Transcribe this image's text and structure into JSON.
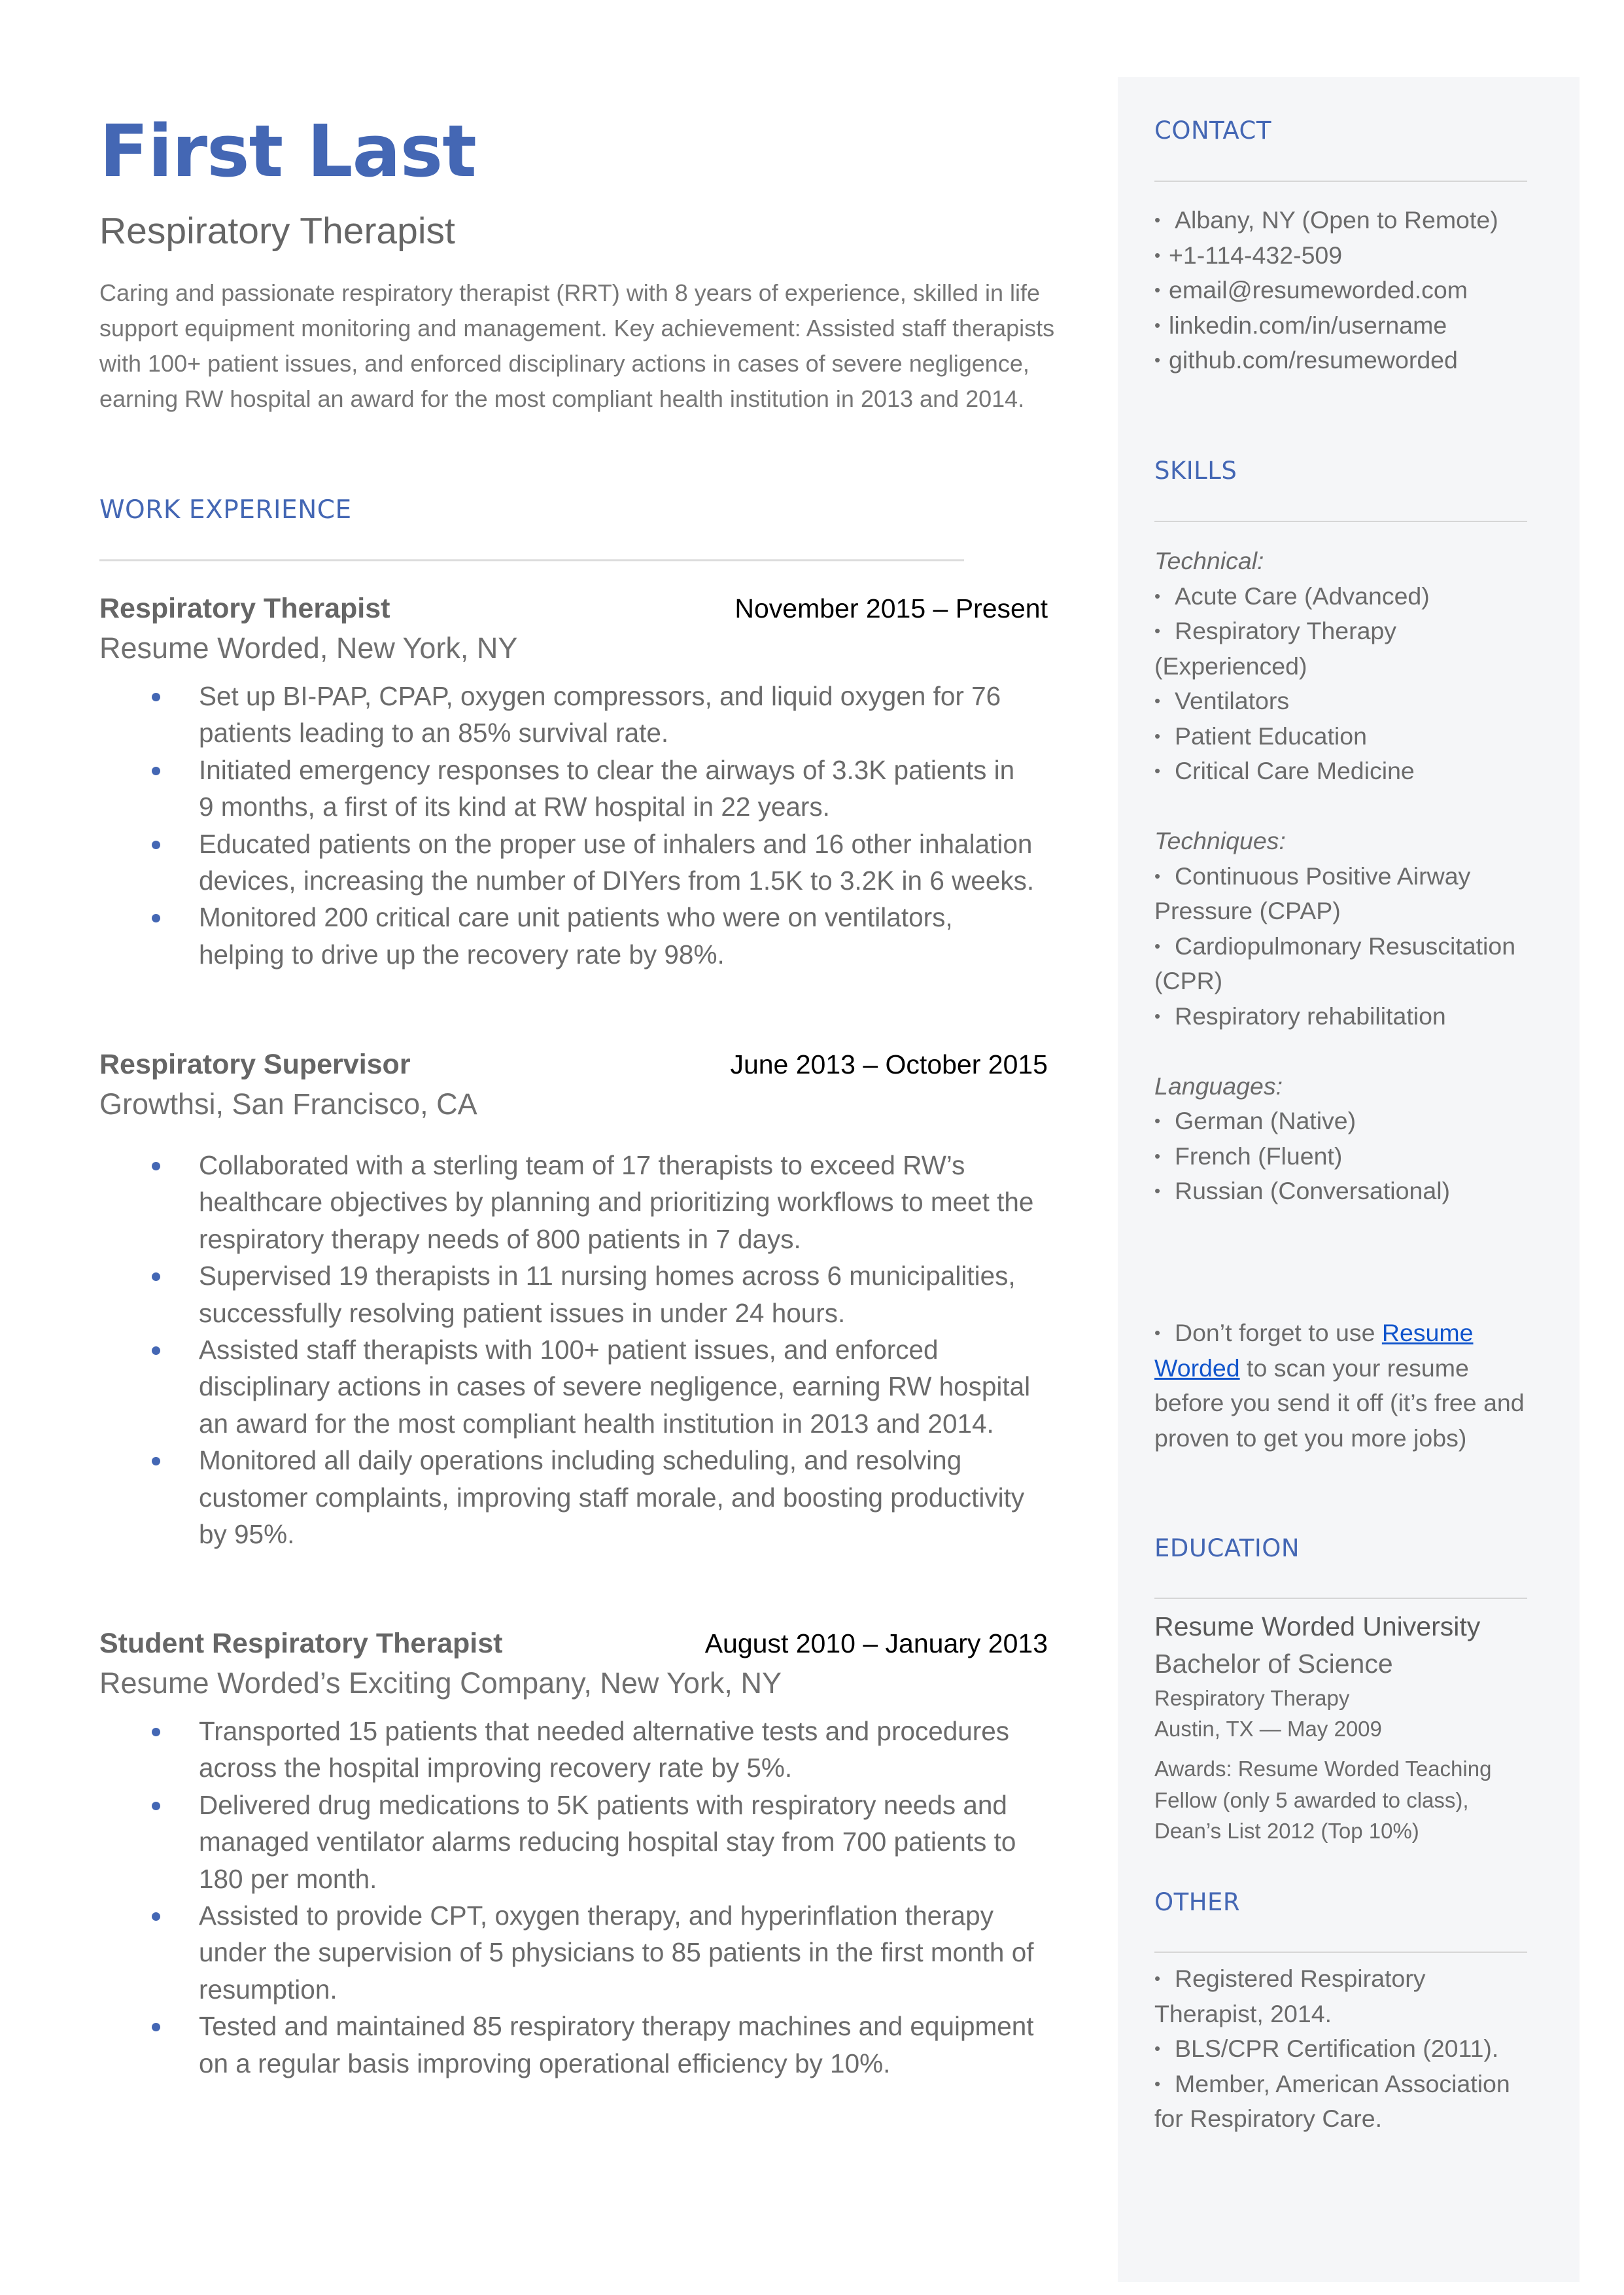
{
  "header": {
    "name": "First Last",
    "title": "Respiratory Therapist",
    "summary": "Caring and passionate respiratory therapist (RRT) with 8 years of experience, skilled in life support equipment monitoring and management. Key achievement: Assisted staff therapists with 100+ patient issues, and enforced disciplinary actions in cases of severe negligence, earning RW hospital an award for the most compliant health institution in 2013 and 2014."
  },
  "colors": {
    "accent": "#4467B4",
    "sidebar_bg": "#F5F6F8",
    "link": "#1155CC",
    "body_text": "#666666"
  },
  "work_experience": {
    "heading": "WORK EXPERIENCE",
    "jobs": [
      {
        "title": "Respiratory Therapist",
        "dates": "November 2015 – Present",
        "company": "Resume Worded, New York, NY",
        "bullets": [
          "Set up BI-PAP, CPAP, oxygen compressors, and liquid oxygen for 76 patients leading to an 85% survival rate.",
          "Initiated emergency responses to clear the airways of 3.3K patients in 9 months, a first of its kind at RW hospital in 22 years.",
          "Educated patients on the proper use of inhalers and 16 other inhalation devices, increasing the number of DIYers from 1.5K to 3.2K in 6 weeks.",
          "Monitored 200 critical care unit patients who were on ventilators, helping to drive up the recovery rate by 98%."
        ]
      },
      {
        "title": "Respiratory Supervisor",
        "dates": "June 2013 – October 2015",
        "company": "Growthsi, San Francisco, CA",
        "bullets": [
          "Collaborated with a sterling team of 17 therapists to exceed RW’s healthcare objectives by planning and prioritizing workflows to meet the respiratory therapy needs of 800 patients in 7 days.",
          "Supervised 19 therapists in 11 nursing homes across 6 municipalities, successfully resolving patient issues in under 24 hours.",
          "Assisted staff therapists with 100+ patient issues, and enforced disciplinary actions in cases of severe negligence, earning RW hospital an award for the most compliant health institution in 2013 and 2014.",
          "Monitored all daily operations including scheduling, and resolving customer complaints, improving staff morale, and boosting productivity by 95%."
        ]
      },
      {
        "title": "Student Respiratory Therapist",
        "dates": "August 2010 – January 2013",
        "company": "Resume Worded’s Exciting Company, New York, NY",
        "bullets": [
          "Transported 15 patients that needed alternative tests and procedures across the hospital improving recovery rate by 5%.",
          "Delivered drug medications to 5K patients with respiratory needs and managed ventilator alarms reducing hospital stay from 700 patients to 180 per month.",
          "Assisted to provide CPT, oxygen therapy, and hyperinflation therapy under the supervision of 5 physicians to 85 patients in the first month of resumption.",
          "Tested and maintained 85 respiratory therapy machines and equipment on a regular basis improving operational efficiency by 10%."
        ]
      }
    ]
  },
  "sidebar": {
    "contact": {
      "heading": "CONTACT",
      "items": [
        "Albany, NY (Open to Remote)",
        "+1-114-432-509",
        "email@resumeworded.com",
        "linkedin.com/in/username",
        "github.com/resumeworded"
      ]
    },
    "skills": {
      "heading": "SKILLS",
      "groups": [
        {
          "label": "Technical:",
          "items": [
            "Acute Care (Advanced)",
            "Respiratory Therapy (Experienced)",
            "Ventilators",
            "Patient Education",
            "Critical Care Medicine"
          ]
        },
        {
          "label": "Techniques:",
          "items": [
            "Continuous Positive Airway Pressure (CPAP)",
            "Cardiopulmonary Resuscitation (CPR)",
            "Respiratory rehabilitation"
          ]
        },
        {
          "label": "Languages:",
          "items": [
            "German (Native)",
            "French (Fluent)",
            "Russian (Conversational)"
          ]
        }
      ]
    },
    "tip": {
      "prefix": "Don’t forget to use ",
      "link_text": "Resume Worded",
      "suffix": " to scan your resume before you send it off (it’s free and proven to get you more jobs)"
    },
    "education": {
      "heading": "EDUCATION",
      "school": "Resume Worded University",
      "degree": "Bachelor of Science",
      "field": "Respiratory Therapy",
      "location_date": "Austin, TX — May 2009",
      "awards": "Awards: Resume Worded Teaching Fellow (only 5 awarded to class), Dean’s List 2012 (Top 10%)"
    },
    "other": {
      "heading": "OTHER",
      "items": [
        "Registered Respiratory Therapist, 2014.",
        "BLS/CPR Certification (2011).",
        "Member, American Association for Respiratory Care."
      ]
    }
  }
}
